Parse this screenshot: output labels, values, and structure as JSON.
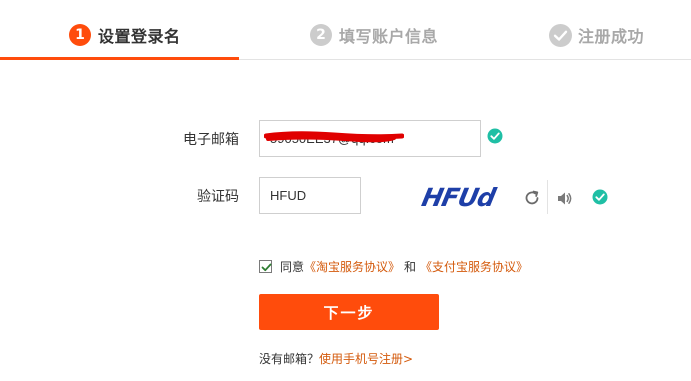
{
  "steps": [
    {
      "num": "1",
      "label": "设置登录名",
      "state": "active"
    },
    {
      "num": "2",
      "label": "填写账户信息",
      "state": "pending"
    },
    {
      "icon": "check-circle-icon",
      "label": "注册成功",
      "state": "pending"
    }
  ],
  "form": {
    "email_label": "电子邮箱",
    "email_value": "59050EE37@qq.com",
    "code_label": "验证码",
    "code_value": "HFUD",
    "captcha_text": "HFUd"
  },
  "agreement": {
    "checked": true,
    "prefix": "同意",
    "link1": "《淘宝服务协议》",
    "conjunction": "和",
    "link2": "《支付宝服务协议》"
  },
  "next_button": "下一步",
  "footer": {
    "question": "没有邮箱？",
    "link": "使用手机号注册>"
  },
  "colors": {
    "accent": "#ff4c0c",
    "link": "#d45a0c",
    "success": "#1fbfa5",
    "inactive": "#cccccc"
  }
}
